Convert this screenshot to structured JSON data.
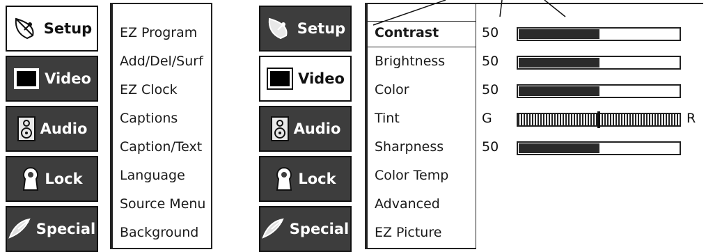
{
  "tabs": [
    {
      "label": "Setup",
      "icon": "satellite-dish-icon"
    },
    {
      "label": "Video",
      "icon": "tv-screen-icon"
    },
    {
      "label": "Audio",
      "icon": "speaker-icon"
    },
    {
      "label": "Lock",
      "icon": "keyhole-icon"
    },
    {
      "label": "Special",
      "icon": "special-dish-icon"
    }
  ],
  "setup_menu": {
    "items": [
      "EZ Program",
      "Add/Del/Surf",
      "EZ Clock",
      "Captions",
      "Caption/Text",
      "Language",
      "Source Menu",
      "Background"
    ]
  },
  "video_menu": {
    "items": [
      "Contrast",
      "Brightness",
      "Color",
      "Tint",
      "Sharpness",
      "Color Temp",
      "Advanced",
      "EZ Picture"
    ],
    "selected": "Contrast"
  },
  "video_values": [
    {
      "label": "Contrast",
      "value": "50",
      "level": 0.5
    },
    {
      "label": "Brightness",
      "value": "50",
      "level": 0.5
    },
    {
      "label": "Color",
      "value": "50",
      "level": 0.5
    },
    {
      "label": "Tint",
      "left": "G",
      "right": "R",
      "level": 0.5
    },
    {
      "label": "Sharpness",
      "value": "50",
      "level": 0.5
    }
  ],
  "colors": {
    "tab_dark": "#3d3d3d",
    "bar_fill": "#2a2a2a"
  }
}
